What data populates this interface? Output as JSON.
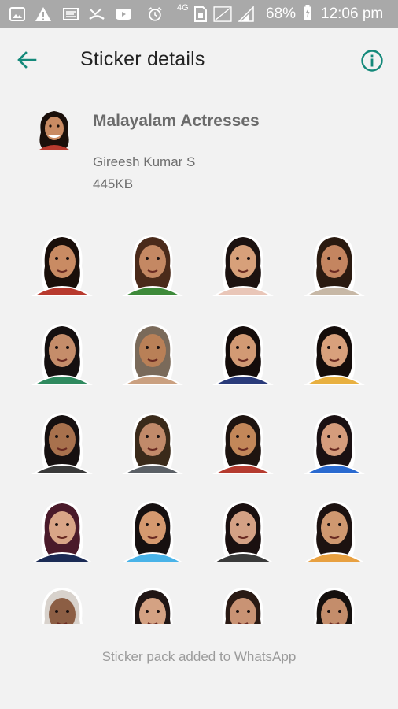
{
  "status_bar": {
    "battery_percent": "68%",
    "time": "12:06 pm",
    "network": "4G"
  },
  "app_bar": {
    "title": "Sticker details",
    "back_icon": "arrow-back-icon",
    "info_icon": "info-icon"
  },
  "pack": {
    "name": "Malayalam Actresses",
    "author": "Gireesh Kumar S",
    "size": "445KB"
  },
  "stickers": [
    {
      "skin": "#c98b63",
      "hair": "#1a0f0a",
      "cloth": "#b83a2e"
    },
    {
      "skin": "#c48863",
      "hair": "#4a2a1a",
      "cloth": "#3e8a3a"
    },
    {
      "skin": "#d7a07a",
      "hair": "#1c1210",
      "cloth": "#e9c6b8"
    },
    {
      "skin": "#c48560",
      "hair": "#2a1a10",
      "cloth": "#c7b8a6"
    },
    {
      "skin": "#c58d6a",
      "hair": "#151010",
      "cloth": "#2f8a5f"
    },
    {
      "skin": "#b98057",
      "hair": "#7a6a5a",
      "cloth": "#caa080"
    },
    {
      "skin": "#d29a74",
      "hair": "#140c0a",
      "cloth": "#2a3b7a"
    },
    {
      "skin": "#d8a07c",
      "hair": "#140c0a",
      "cloth": "#e8b040"
    },
    {
      "skin": "#a8714d",
      "hair": "#161010",
      "cloth": "#3a3a3a"
    },
    {
      "skin": "#c18a6a",
      "hair": "#3a2a1a",
      "cloth": "#5b6066"
    },
    {
      "skin": "#c38759",
      "hair": "#1e1410",
      "cloth": "#b53b2f"
    },
    {
      "skin": "#d59c7c",
      "hair": "#1a1012",
      "cloth": "#2a6ad0"
    },
    {
      "skin": "#d9a587",
      "hair": "#4a1a2a",
      "cloth": "#1b2b55"
    },
    {
      "skin": "#d5996f",
      "hair": "#161010",
      "cloth": "#49b3e8"
    },
    {
      "skin": "#d4a185",
      "hair": "#1a1010",
      "cloth": "#3a3a3a"
    },
    {
      "skin": "#cf9870",
      "hair": "#1c1210",
      "cloth": "#e8a040"
    },
    {
      "skin": "#8c5e44",
      "hair": "#d8d2cc",
      "cloth": "#ffffff"
    },
    {
      "skin": "#d4a283",
      "hair": "#201615",
      "cloth": "#ffffff"
    },
    {
      "skin": "#c99374",
      "hair": "#2a1a14",
      "cloth": "#ffffff"
    },
    {
      "skin": "#c48d6b",
      "hair": "#15100e",
      "cloth": "#ffffff"
    }
  ],
  "footer": {
    "status": "Sticker pack added to WhatsApp"
  },
  "colors": {
    "accent": "#14897a",
    "status_bar": "#a9a9a9",
    "background": "#f2f2f2"
  }
}
